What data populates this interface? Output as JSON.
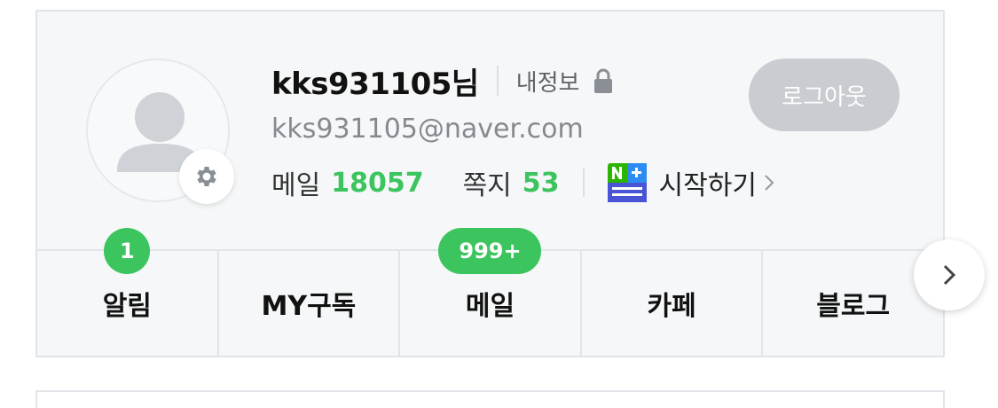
{
  "profile": {
    "username": "kks931105님",
    "myinfo_label": "내정보",
    "email": "kks931105@naver.com",
    "logout_label": "로그아웃"
  },
  "stats": {
    "mail_label": "메일",
    "mail_count": "18057",
    "note_label": "쪽지",
    "note_count": "53",
    "nplus_start_label": "시작하기"
  },
  "tabs": [
    {
      "label": "알림",
      "badge": "1"
    },
    {
      "label": "MY구독"
    },
    {
      "label": "메일",
      "badge": "999+"
    },
    {
      "label": "카페"
    },
    {
      "label": "블로그"
    }
  ],
  "colors": {
    "accent": "#3cc45e",
    "logout_bg": "#c9ccd0",
    "panel_bg": "#f5f7f8"
  },
  "icons": [
    "avatar-placeholder-icon",
    "gear-icon",
    "lock-icon",
    "naver-plus-membership-icon",
    "chevron-right-icon"
  ]
}
